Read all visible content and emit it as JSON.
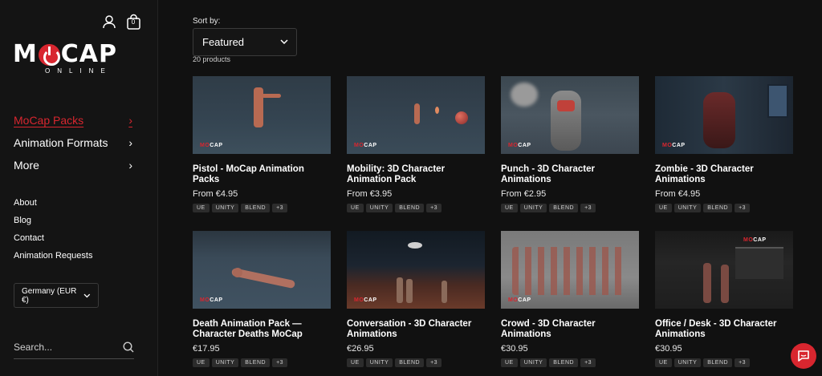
{
  "header": {
    "account_icon": "user-icon",
    "cart_icon": "shopping-bag-icon",
    "cart_count": "0"
  },
  "logo": {
    "word_left": "M",
    "word_right": "CAP",
    "subtitle": "ONLINE"
  },
  "sidebar": {
    "nav": [
      {
        "label": "MoCap Packs"
      },
      {
        "label": "Animation Formats"
      },
      {
        "label": "More"
      }
    ],
    "links": [
      {
        "label": "About"
      },
      {
        "label": "Blog"
      },
      {
        "label": "Contact"
      },
      {
        "label": "Animation Requests"
      }
    ],
    "country": "Germany (EUR €)",
    "search_placeholder": "Search..."
  },
  "sort": {
    "label": "Sort by:",
    "selected": "Featured",
    "count": "20 products"
  },
  "products": [
    {
      "title": "Pistol - MoCap Animation Packs",
      "price": "From €4.95",
      "tags": [
        "UE",
        "UNITY",
        "BLEND",
        "+3"
      ]
    },
    {
      "title": "Mobility: 3D Character Animation Pack",
      "price": "From €3.95",
      "tags": [
        "UE",
        "UNITY",
        "BLEND",
        "+3"
      ]
    },
    {
      "title": "Punch - 3D Character Animations",
      "price": "From €2.95",
      "tags": [
        "UE",
        "UNITY",
        "BLEND",
        "+3"
      ]
    },
    {
      "title": "Zombie - 3D Character Animations",
      "price": "From €4.95",
      "tags": [
        "UE",
        "UNITY",
        "BLEND",
        "+3"
      ]
    },
    {
      "title": "Death Animation Pack — Character Deaths MoCap",
      "price": "€17.95",
      "tags": [
        "UE",
        "UNITY",
        "BLEND",
        "+3"
      ]
    },
    {
      "title": "Conversation - 3D Character Animations",
      "price": "€26.95",
      "tags": [
        "UE",
        "UNITY",
        "BLEND",
        "+3"
      ]
    },
    {
      "title": "Crowd - 3D Character Animations",
      "price": "€30.95",
      "tags": [
        "UE",
        "UNITY",
        "BLEND",
        "+3"
      ]
    },
    {
      "title": "Office / Desk - 3D Character Animations",
      "price": "€30.95",
      "tags": [
        "UE",
        "UNITY",
        "BLEND",
        "+3"
      ]
    }
  ],
  "thumb_logo": {
    "a": "M",
    "b": "O",
    "c": "CAP"
  },
  "chat_icon": "chat-bubble-icon"
}
